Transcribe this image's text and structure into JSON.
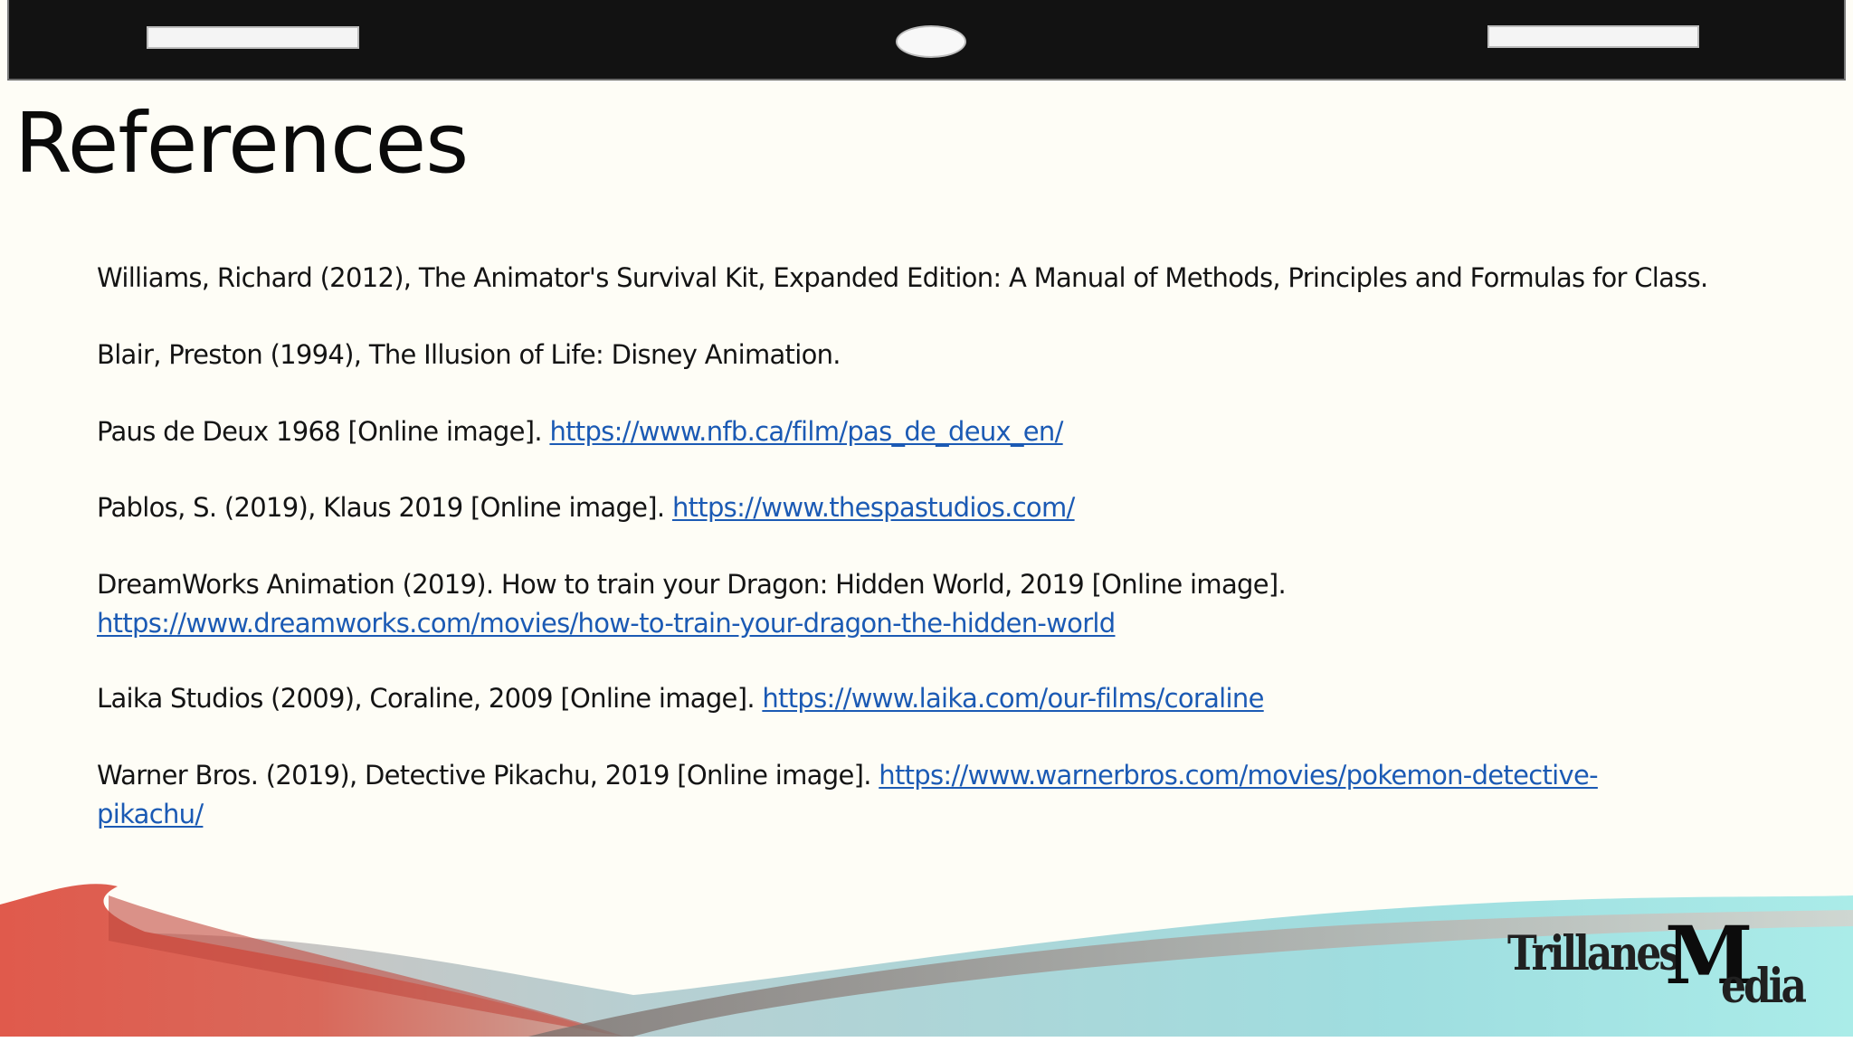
{
  "slide": {
    "title": "References"
  },
  "references": [
    {
      "text": "Williams, Richard (2012), The Animator's Survival Kit, Expanded Edition: A Manual of Methods, Principles and Formulas for Class.",
      "link": ""
    },
    {
      "text": "Blair, Preston (1994), The Illusion of Life: Disney Animation.",
      "link": ""
    },
    {
      "text": "Paus de Deux 1968 [Online image]. ",
      "link": "https://www.nfb.ca/film/pas_de_deux_en/"
    },
    {
      "text": "Pablos, S. (2019), Klaus 2019 [Online image]. ",
      "link": "https://www.thespastudios.com/"
    },
    {
      "text": "DreamWorks Animation (2019). How to train your Dragon: Hidden World, 2019 [Online image].",
      "link": "https://www.dreamworks.com/movies/how-to-train-your-dragon-the-hidden-world"
    },
    {
      "text": "Laika Studios (2009), Coraline, 2009 [Online image]. ",
      "link": "https://www.laika.com/our-films/coraline"
    },
    {
      "text": "Warner Bros. (2019), Detective Pikachu, 2019 [Online image]. ",
      "link": "https://www.warnerbros.com/movies/pokemon-detective-",
      "link_cont": "pikachu/"
    }
  ],
  "logo": {
    "part1": "Trillanes",
    "part2": "M",
    "part3": "edia"
  }
}
